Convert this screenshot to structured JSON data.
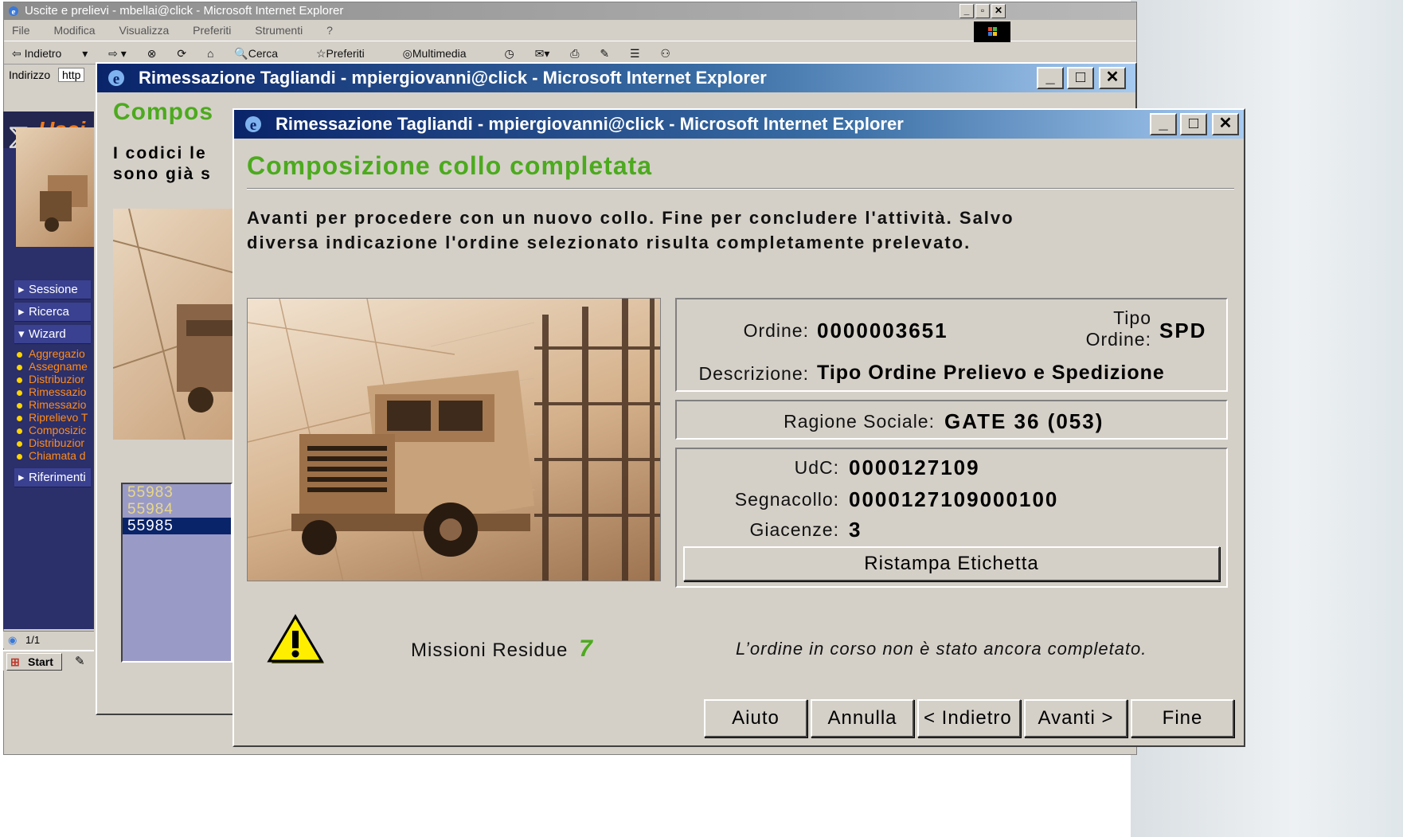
{
  "back_window": {
    "title": "Uscite e prelievi - mbellai@click - Microsoft Internet Explorer",
    "menu": [
      "File",
      "Modifica",
      "Visualizza",
      "Preferiti",
      "Strumenti",
      "?"
    ],
    "toolbar": [
      "Indietro",
      "Cerca",
      "Preferiti",
      "Multimedia"
    ],
    "address_label": "Indirizzo",
    "address_value": "http",
    "app_title": "Usci",
    "nav": {
      "sessione": "Sessione",
      "ricerca": "Ricerca",
      "wizard": "Wizard",
      "riferimenti": "Riferimenti",
      "links": [
        "Aggregazio",
        "Assegname",
        "Distribuzior",
        "Rimessazio",
        "Rimessazio",
        "Riprelievo T",
        "Composizic",
        "Distribuzior",
        "Chiamata d"
      ]
    },
    "status_text": "1/1",
    "start_label": "Start"
  },
  "middle_window": {
    "title": "Rimessazione Tagliandi - mpiergiovanni@click - Microsoft Internet Explorer",
    "heading": "Compos",
    "text_line1": "I codici le",
    "text_line2": "sono già s",
    "list": [
      "55983",
      "55984",
      "55985"
    ],
    "list_selected": "55985"
  },
  "front_window": {
    "title": "Rimessazione Tagliandi - mpiergiovanni@click - Microsoft Internet Explorer",
    "heading": "Composizione collo completata",
    "intro_line1": "Avanti per procedere con un nuovo collo. Fine per concludere l'attività. Salvo",
    "intro_line2": "diversa indicazione l'ordine selezionato risulta completamente prelevato.",
    "order": {
      "ordine_label": "Ordine:",
      "ordine_value": "0000003651",
      "tipo_label_1": "Tipo",
      "tipo_label_2": "Ordine:",
      "tipo_value": "SPD",
      "descrizione_label": "Descrizione:",
      "descrizione_value": "Tipo Ordine Prelievo e Spedizione"
    },
    "ragione": {
      "label": "Ragione Sociale:",
      "value": "GATE 36 (053)"
    },
    "udc": {
      "udc_label": "UdC:",
      "udc_value": "0000127109",
      "segnacollo_label": "Segnacollo:",
      "segnacollo_value": "0000127109000100",
      "giacenze_label": "Giacenze:",
      "giacenze_value": "3",
      "reprint_label": "Ristampa Etichetta"
    },
    "missioni_label": "Missioni Residue",
    "missioni_value": "7",
    "warning_text": "L’ordine in corso non è stato ancora completato.",
    "buttons": {
      "aiuto": "Aiuto",
      "annulla": "Annulla",
      "indietro": "< Indietro",
      "avanti": "Avanti >",
      "fine": "Fine"
    }
  },
  "colors": {
    "heading_green": "#4caa1e",
    "title_blue": "#0a246a",
    "nav_orange": "#ff8c1a",
    "nav_bg": "#2b2f6a"
  }
}
